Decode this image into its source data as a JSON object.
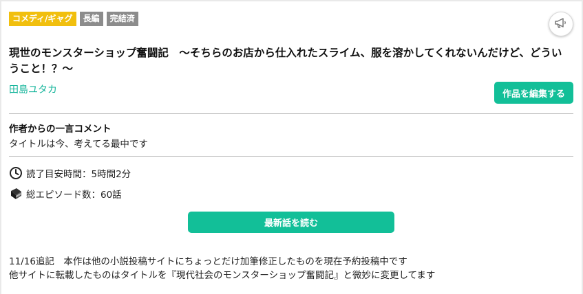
{
  "tags": [
    {
      "label": "コメディ/ギャグ"
    },
    {
      "label": "長編"
    },
    {
      "label": "完結済"
    }
  ],
  "share": {
    "icon": "megaphone-icon"
  },
  "work": {
    "title": "現世のモンスターショップ奮闘記　～そちらのお店から仕入れたスライム、服を溶かしてくれないんだけど、どういうこと！？～",
    "author": "田島ユタカ"
  },
  "buttons": {
    "edit_label": "作品を編集する",
    "read_label": "最新話を読む"
  },
  "comment": {
    "heading": "作者からの一言コメント",
    "text": "タイトルは今、考えてる最中です"
  },
  "info": {
    "reading_time": "読了目安時間：5時間2分",
    "episodes": "総エピソード数：60話",
    "reading_time_icon": "clock-icon",
    "episodes_icon": "book-icon"
  },
  "description": {
    "lines": [
      "11/16追記　本作は他の小説投稿サイトにちょっとだけ加筆修正したものを現在予約投稿中です",
      "他サイトに転載したものはタイトルを『現代社会のモンスターショップ奮闘記』と微妙に変更してます"
    ]
  },
  "colors": {
    "accent": "#12bf98",
    "author_link": "#13b49a",
    "genre_tag": "#f1bf0e",
    "gray_tag": "#8c8c8c"
  }
}
